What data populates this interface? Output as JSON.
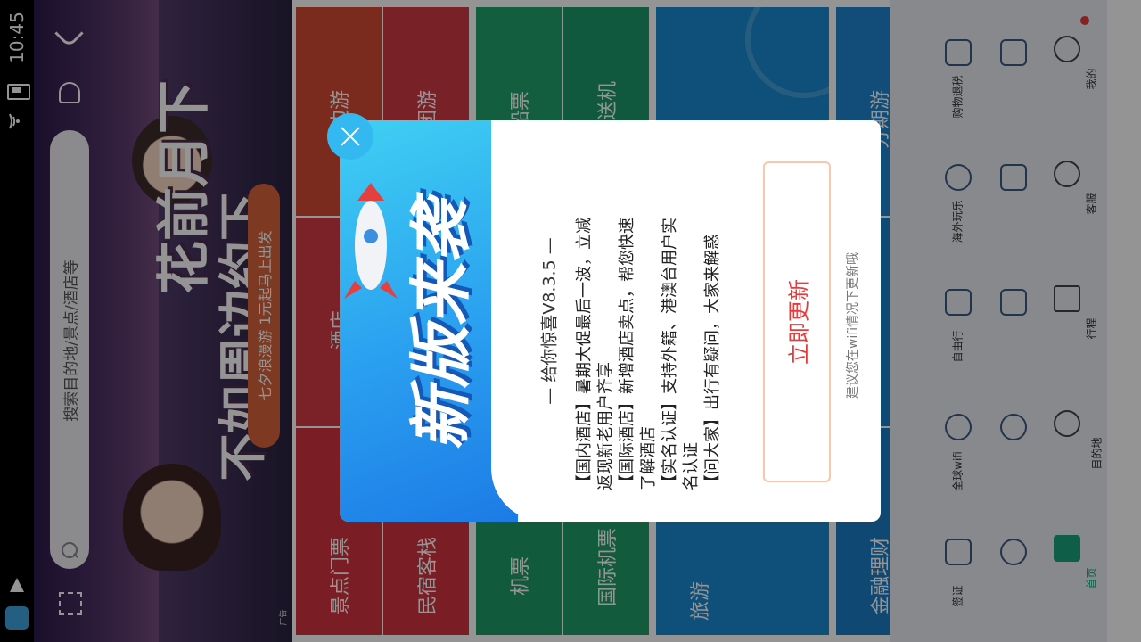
{
  "status_bar": {
    "time": "10:45"
  },
  "hero": {
    "title_line1": "花前月下",
    "title_line2": "不如周边约下",
    "tagline": "七夕浪漫游  1元起马上出发",
    "ad_tag": "广告"
  },
  "search": {
    "placeholder": "搜索目的地/景点/酒店等"
  },
  "tiles": {
    "col1": [
      "景点门票",
      "酒店",
      "周边游"
    ],
    "col2": [
      "民宿客栈",
      "跟团游"
    ],
    "col3": [
      "机票",
      "船票"
    ],
    "col4": [
      "国际机票",
      "接送机"
    ],
    "col5": [
      "旅游"
    ],
    "col6": [
      "金融理财",
      "分期游"
    ]
  },
  "menu": {
    "row1": [
      {
        "label": "签证",
        "icon": "visa-icon"
      },
      {
        "label": "全球wifi",
        "icon": "wifi-icon"
      },
      {
        "label": "自由行",
        "icon": "suitcase-icon"
      },
      {
        "label": "海外玩乐",
        "icon": "balloon-icon"
      },
      {
        "label": "购物退税",
        "icon": "cart-icon"
      }
    ],
    "row2": [
      {
        "label": "",
        "icon": "location-icon"
      },
      {
        "label": "",
        "icon": "gear-icon"
      },
      {
        "label": "",
        "icon": "crown-icon"
      },
      {
        "label": "",
        "icon": "book-icon"
      },
      {
        "label": "",
        "icon": "grid-icon"
      }
    ],
    "nav": [
      {
        "label": "首页",
        "icon": "home-icon",
        "active": true
      },
      {
        "label": "目的地",
        "icon": "globe-icon"
      },
      {
        "label": "行程",
        "icon": "calendar-icon"
      },
      {
        "label": "客服",
        "icon": "headset-icon"
      },
      {
        "label": "我的",
        "icon": "user-icon"
      }
    ]
  },
  "dialog": {
    "banner_text": "新版来袭",
    "heading": "—  给你惊喜V8.3.5  —",
    "notes": [
      "【国内酒店】暑期大促最后一波，立减",
      "返现新老用户齐享",
      "【国际酒店】新增酒店卖点，帮您快速",
      "了解酒店",
      "【实名认证】支持外籍、港澳台用户实",
      "名认证",
      "【问大家】出行有疑问，大家来解惑"
    ],
    "update_button": "立即更新",
    "wifi_tip": "建议您在wifi情况下更新哦"
  },
  "colors": {
    "red_tile": "#d8363d",
    "green_tile": "#23a26f",
    "blue_tile": "#1a8bd4",
    "update_red": "#e83a3a"
  }
}
